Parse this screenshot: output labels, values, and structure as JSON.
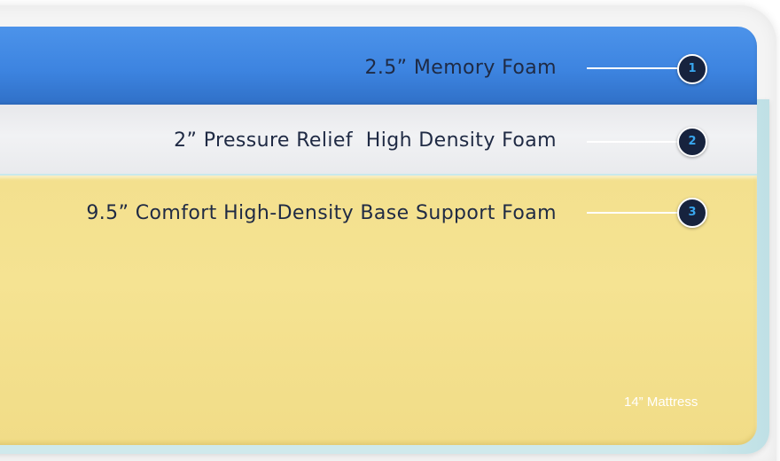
{
  "layers": [
    {
      "number": "1",
      "label": "2.5” Memory Foam",
      "color": "#3d84e0"
    },
    {
      "number": "2",
      "label": "2” Pressure Relief  High Density Foam",
      "color": "#eeeff1"
    },
    {
      "number": "3",
      "label": "9.5” Comfort High-Density Base Support Foam",
      "color": "#f3e08e"
    }
  ],
  "size_note": "14” Mattress",
  "colors": {
    "label_text": "#1f2a44",
    "badge_fill": "#17233e",
    "badge_number": "#39a7ef",
    "side_edge": "#cfe9ec"
  }
}
